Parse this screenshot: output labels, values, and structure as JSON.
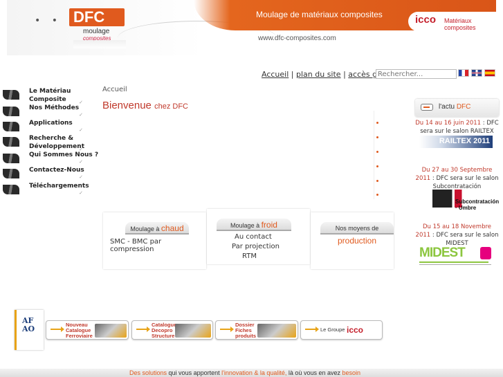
{
  "banner": {
    "dots": "• • •",
    "logo": "DFC",
    "logo_sub": "moulage",
    "logo_sub2": "composites",
    "tagline": "Moulage de matériaux composites",
    "icco_logo": "icco",
    "icco_text": "Matériaux composites",
    "url": "www.dfc-composites.com"
  },
  "topnav": {
    "links": [
      "Accueil",
      "plan du site",
      "accès groupe"
    ],
    "separator": "|",
    "search_placeholder": "Rechercher...",
    "flags": [
      "flag-fr-icon",
      "flag-en-icon",
      "flag-es-icon"
    ]
  },
  "menu": [
    {
      "label": "Le Matériau Composite"
    },
    {
      "label": "Nos Méthodes"
    },
    {
      "label": "Applications"
    },
    {
      "label": "Recherche & Développement"
    },
    {
      "label": "Qui Sommes Nous ?"
    },
    {
      "label": "Contactez-Nous"
    },
    {
      "label": "Téléchargements"
    }
  ],
  "main": {
    "breadcrumb": "Accueil",
    "welcome_big": "Bienvenue",
    "welcome_small": "chez DFC"
  },
  "boxes": [
    {
      "tab_prefix": "Moulage à",
      "tab_accent": "chaud",
      "lines": [
        "SMC - BMC par compression"
      ]
    },
    {
      "tab_prefix": "Moulage à",
      "tab_accent": "froid",
      "lines": [
        "Au contact",
        "Par projection",
        "RTM"
      ]
    },
    {
      "tab_prefix": "Nos moyens de",
      "tab_accent": "production",
      "lines": []
    }
  ],
  "actu": {
    "title_prefix": "l'actu",
    "title_accent": "DFC",
    "news": [
      {
        "date": "Du 14 au 16 juin 2011",
        "text": ": DFC sera sur le salon RAILTEX",
        "img_label": "RAILTEX 2011"
      },
      {
        "date": "Du 27 au 30 Septembre 2011",
        "text": ": DFC sera sur le salon Subcontratación",
        "img_label": "Subcontratación · Umbre"
      },
      {
        "date": "Du 15 au 18 Novembre 2011",
        "text": ": DFC sera sur le salon MIDEST",
        "img_label": "MIDEST"
      }
    ]
  },
  "promos": {
    "afao": "AF\nAO",
    "items": [
      {
        "label": "Nouveau\nCatalogue\nFerroviaire"
      },
      {
        "label": "Catalogue\nDecopro\nStructure"
      },
      {
        "label": "Dossier\nFiches\nproduits"
      },
      {
        "label": "Le Groupe",
        "logo": "icco"
      }
    ]
  },
  "footer": {
    "p1": "Des solutions",
    "p2": "qui vous apportent",
    "p3": "l'innovation & la qualité,",
    "p4": "là où vous en avez",
    "p5": "besoin"
  },
  "colors": {
    "accent": "#e05a1e",
    "red": "#c0392b",
    "gold": "#e8a317"
  }
}
